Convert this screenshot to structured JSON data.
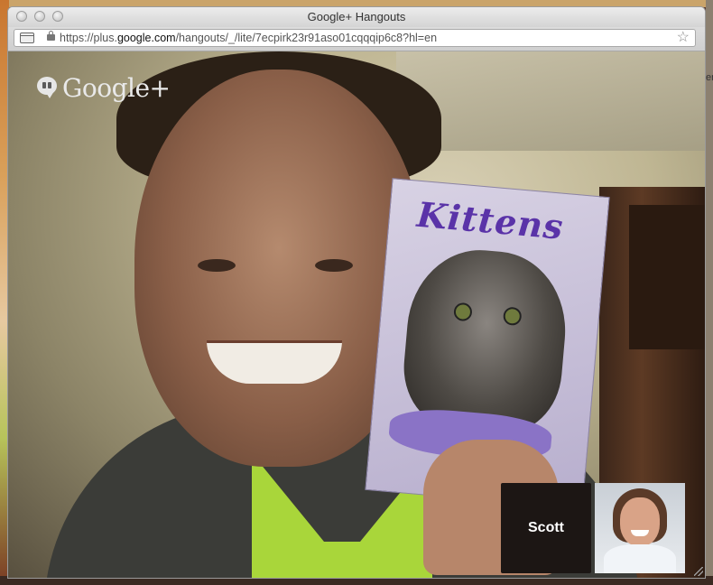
{
  "window": {
    "title": "Google+ Hangouts"
  },
  "address_bar": {
    "url_prefix": "https://plus.",
    "url_host": "google.com",
    "url_path": "/hangouts/_/lite/7ecpirk23r91aso01cqqqip6c8?hl=en"
  },
  "overlay": {
    "brand": "Google+",
    "icon": "hangouts-icon"
  },
  "scene": {
    "book_title": "Kittens"
  },
  "participants": [
    {
      "name": "Scott",
      "type": "name-card"
    },
    {
      "name": "",
      "type": "self-view"
    }
  ],
  "desktop": {
    "edge_text": "er"
  }
}
